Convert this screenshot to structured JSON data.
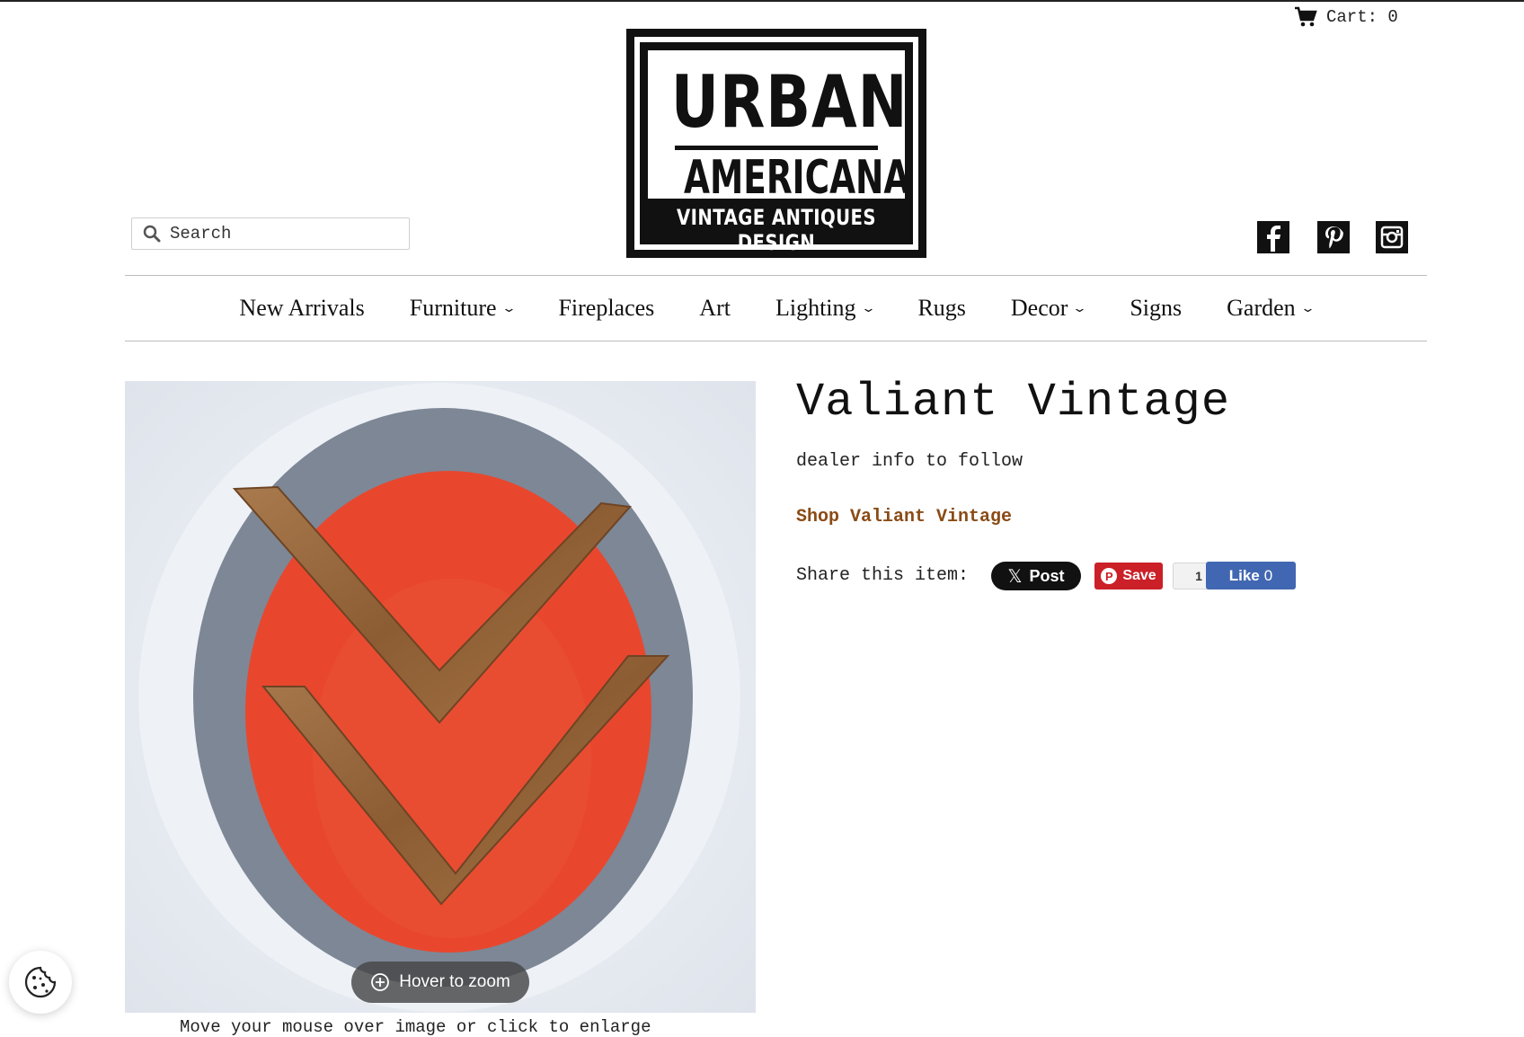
{
  "header": {
    "cart_label": "Cart: 0",
    "search_placeholder": "Search",
    "logo": {
      "line1": "URBAN",
      "line2": "AMERICANA",
      "line3": "VINTAGE ANTIQUES DESIGN"
    },
    "social": [
      "facebook-icon",
      "pinterest-icon",
      "instagram-icon"
    ]
  },
  "nav": {
    "items": [
      {
        "label": "New Arrivals",
        "dropdown": false
      },
      {
        "label": "Furniture",
        "dropdown": true
      },
      {
        "label": "Fireplaces",
        "dropdown": false
      },
      {
        "label": "Art",
        "dropdown": false
      },
      {
        "label": "Lighting",
        "dropdown": true
      },
      {
        "label": "Rugs",
        "dropdown": false
      },
      {
        "label": "Decor",
        "dropdown": true
      },
      {
        "label": "Signs",
        "dropdown": false
      },
      {
        "label": "Garden",
        "dropdown": true
      }
    ],
    "chevron": "⌄"
  },
  "product": {
    "title": "Valiant Vintage",
    "dealer_info": "dealer info to follow",
    "shop_link": "Shop Valiant Vintage",
    "share_label": "Share this item:",
    "zoom_label": "Hover to zoom",
    "zoom_hint": "Move your mouse over image or click to enlarge"
  },
  "share": {
    "x_label": "Post",
    "x_glyph": "𝕏",
    "pin_label": "Save",
    "pin_glyph": "P",
    "fb_count": "1",
    "fb_like_label": "Like",
    "fb_like_count": "0"
  },
  "colors": {
    "shop_link": "#8a4b15",
    "pinterest": "#cb2027",
    "facebook": "#4267b2"
  }
}
